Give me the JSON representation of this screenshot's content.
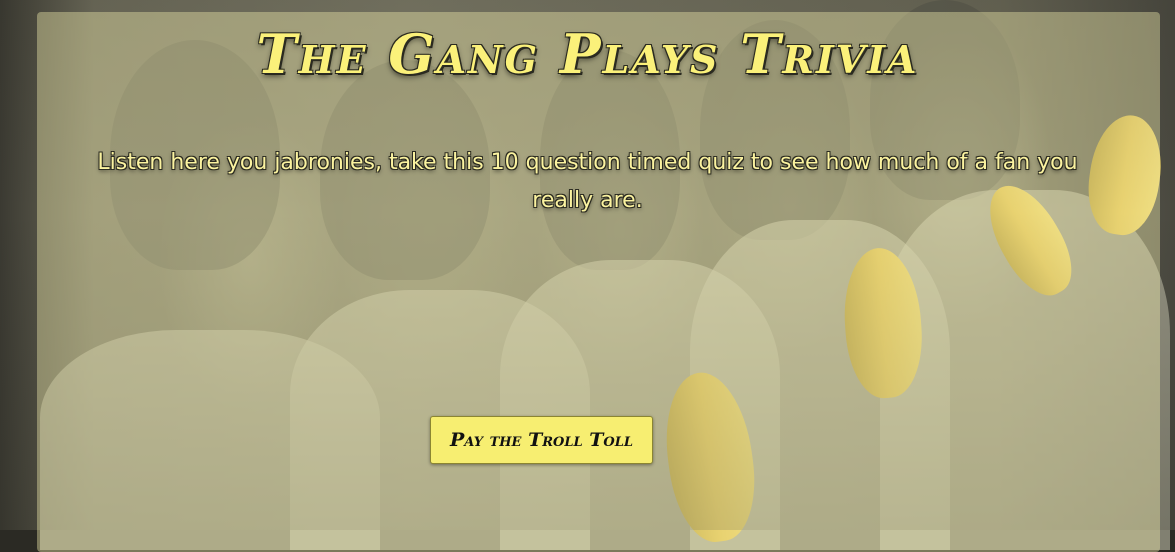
{
  "page": {
    "title": "The Gang Plays Trivia",
    "intro": "Listen here you jabronies, take this 10 question timed quiz to see how much of a fan you really are."
  },
  "actions": {
    "start_label": "Pay the Troll Toll"
  },
  "background": {
    "image_icon": "group-photo-with-bananas",
    "panel_color": "#ebe8aa",
    "title_color": "#fbf17a",
    "button_color": "#f7ee71"
  }
}
